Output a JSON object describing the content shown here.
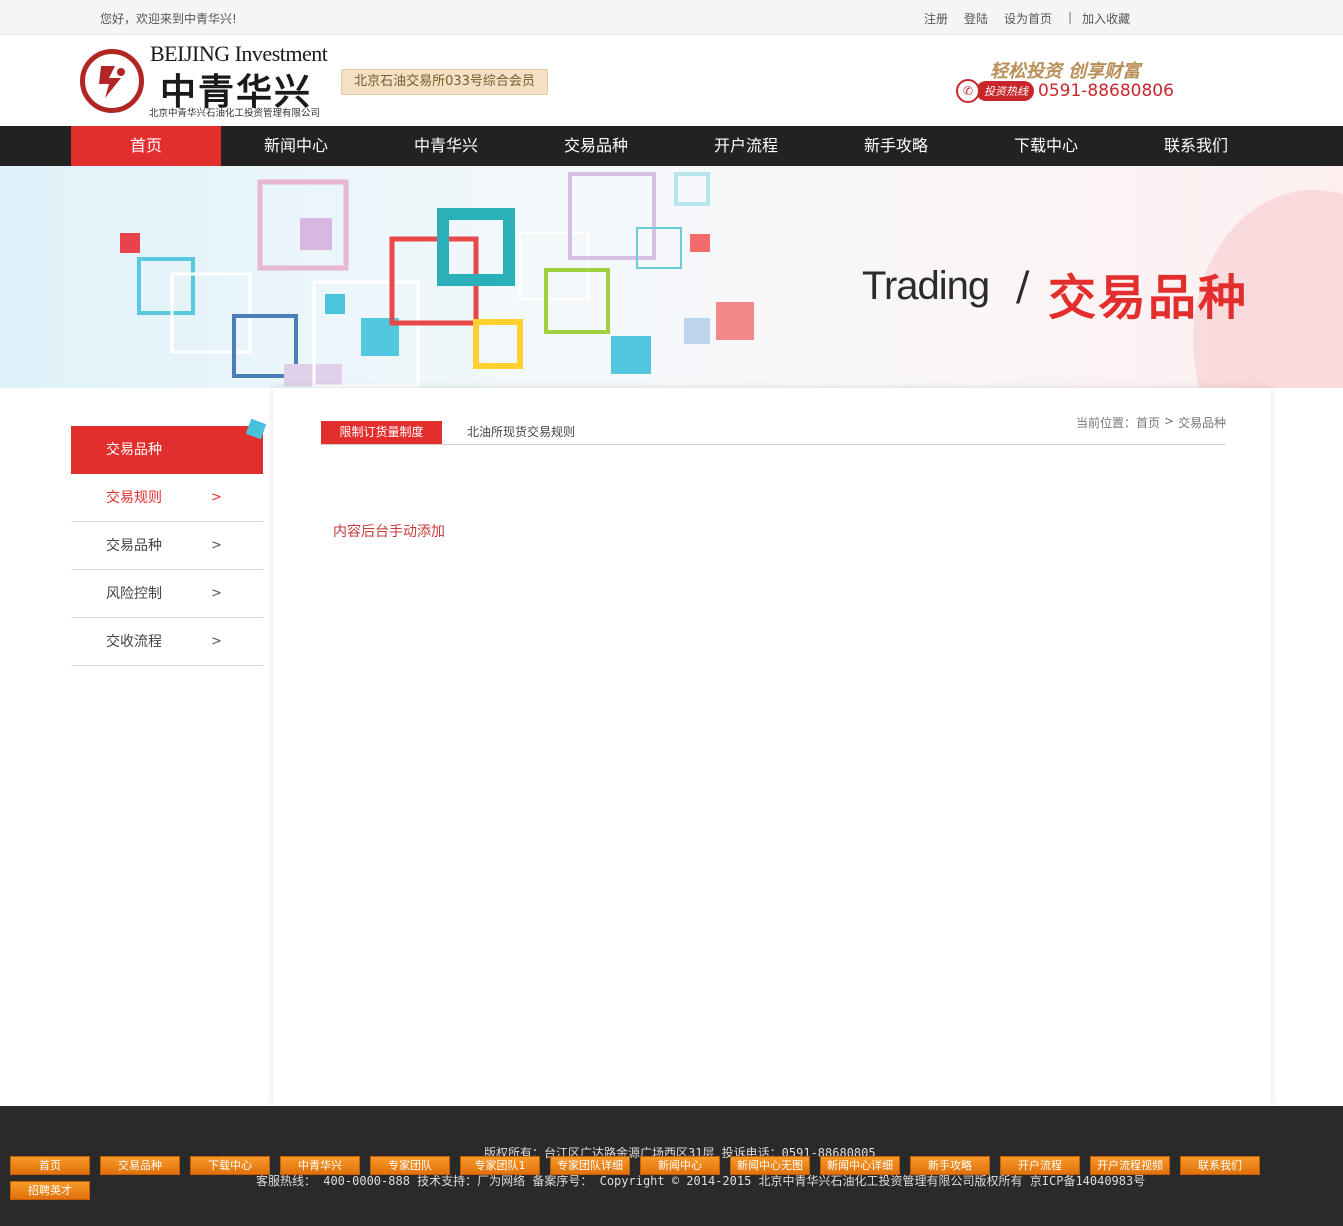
{
  "topbar": {
    "welcome": "您好，欢迎来到中青华兴!",
    "register": "注册",
    "login": "登陆",
    "set_home": "设为首页",
    "separator": "|",
    "bookmark": "加入收藏"
  },
  "header": {
    "logo_en": "BEIJING Investment",
    "logo_cn": "中青华兴",
    "logo_sub": "北京中青华兴石油化工投资管理有限公司",
    "member_badge": "北京石油交易所033号综合会员",
    "slogan": "轻松投资 创享财富",
    "hotline_label": "投资热线",
    "hotline_number": "0591-88680806"
  },
  "nav": {
    "items": [
      "首页",
      "新闻中心",
      "中青华兴",
      "交易品种",
      "开户流程",
      "新手攻略",
      "下载中心",
      "联系我们"
    ],
    "active_index": 0
  },
  "banner": {
    "title_en": "Trading",
    "slash": "/",
    "title_cn": "交易品种"
  },
  "sidebar": {
    "title": "交易品种",
    "items": [
      {
        "label": "交易规则",
        "arrow": ">"
      },
      {
        "label": "交易品种",
        "arrow": ">"
      },
      {
        "label": "风险控制",
        "arrow": ">"
      },
      {
        "label": "交收流程",
        "arrow": ">"
      }
    ]
  },
  "content": {
    "tabs": [
      "限制订货量制度",
      "北油所现货交易规则"
    ],
    "breadcrumb": {
      "prefix": "当前位置：",
      "home": "首页",
      "sep": ">",
      "current": "交易品种"
    },
    "body_text": "内容后台手动添加"
  },
  "footer": {
    "line1": "版权所有：台江区广达路金源广场西区31层 投诉电话：0591-88680805",
    "line2": "客服热线： 400-0000-888 技术支持：厂为网络 备案序号： Copyright © 2014-2015 北京中青华兴石油化工投资管理有限公司版权所有 京ICP备14040983号",
    "buttons": [
      "首页",
      "交易品种",
      "下载中心",
      "中青华兴",
      "专家团队",
      "专家团队1",
      "专家团队详细",
      "新闻中心",
      "新闻中心无图",
      "新闻中心详细",
      "新手攻略",
      "开户流程",
      "开户流程视频",
      "联系我们",
      "招聘英才"
    ]
  },
  "colors": {
    "accent": "#e32e2e",
    "nav_bg": "#222222",
    "footer_bg": "#2a2a2a",
    "button_orange": "#f08a1c"
  }
}
